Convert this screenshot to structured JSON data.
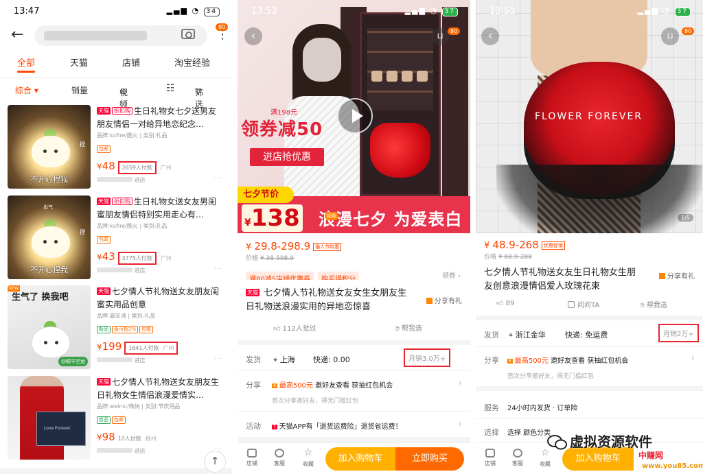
{
  "screen1": {
    "status": {
      "time": "13:47",
      "battery": "34"
    },
    "badge": "80",
    "tabs": [
      "全部",
      "天猫",
      "店铺",
      "淘宝经验"
    ],
    "filters": [
      "综合 ▾",
      "销量",
      "视频",
      "筛选"
    ],
    "items": [
      {
        "tags": [
          "天猫",
          "折扣购"
        ],
        "title": "生日礼物女七夕送男友朋友情侣一对给异地恋纪念…",
        "meta": "品牌:kufire/酷火 | 类别:礼品",
        "badges": [
          "包邮"
        ],
        "price": "48",
        "sold": "2659人付款",
        "location": "广州",
        "shop": "进店",
        "thumb_caption": "不开心捏我",
        "thumb_side": "捏"
      },
      {
        "tags": [
          "天猫",
          "折扣购"
        ],
        "title": "生日礼物女送女友男闺蜜朋友情侣特别实用走心有…",
        "meta": "品牌:kufire/酷火 | 类别:礼品",
        "badges": [
          "包邮"
        ],
        "price": "43",
        "sold": "3775人付款",
        "location": "广州",
        "shop": "进店",
        "thumb_caption": "不开心捏我",
        "thumb_side": "捏",
        "thumb_top": "出气"
      },
      {
        "tags": [
          "天猫"
        ],
        "title": "七夕情人节礼物送女友朋友闺蜜实用品创意",
        "meta": "品牌:赢安谱 | 类别:礼品",
        "badges": [
          "新品",
          "金币抵2%",
          "包邮"
        ],
        "price": "199",
        "sold": "1641人付款",
        "location": "广州",
        "shop": "进店",
        "thumb_top": "生气了 换我吧",
        "thumb_ribbon": "@顺丰空运",
        "thumb_corner": "NEW"
      },
      {
        "tags": [
          "天猫"
        ],
        "title": "七夕情人节礼物送女友朋友生日礼物女生情侣浪漫爱情实…",
        "meta": "品牌:welnic/微纳 | 类别:节庆用品",
        "badges": [
          "新品",
          "包邮"
        ],
        "price": "98",
        "sold": "10人付款",
        "location": "扬州",
        "shop": "进店",
        "box_text": "Love Forever"
      }
    ],
    "backtop": "↑"
  },
  "screen2": {
    "status": {
      "time": "13:53",
      "battery": "37"
    },
    "badge": "80",
    "promo_small": "满198元",
    "promo_big": "领券减50",
    "promo_button": "进店抢优惠",
    "qixi_label": "七夕节价",
    "qixi_price": "138",
    "slogan": "浪漫七夕 为爱表白",
    "video_tag": "视频",
    "price_range": "29.8-298.9",
    "price_tag": "猫人节特惠",
    "orig_label": "价格",
    "orig_price": "¥ 38-598.9",
    "coupons": [
      "满80减5店铺优惠券",
      "购买得积分"
    ],
    "coupon_right": "领券 ›",
    "title_tag": "天猫",
    "title": "七夕情人节礼物送女友女生女朋友生日礼物送浪漫实用的异地恋惊喜",
    "share": "分享有礼",
    "likes": "112人觉过",
    "help": "帮我选",
    "ship_label": "发货",
    "ship_loc": "上海",
    "ship_fee": "快递: 0.00",
    "monthly": "月销3.0万+",
    "share_label": "分享",
    "share_badge": "最高500元",
    "share_text": "邀好友查看 获抽红包机会",
    "share_sub": "首次分享邀好友，得无门槛红包",
    "activity_label": "活动",
    "activity_text": "天猫APP有「退货运费险」退货省运费！",
    "bottom": {
      "store": "店铺",
      "service": "客服",
      "fav": "收藏",
      "cart": "加入购物车",
      "buy": "立即购买"
    }
  },
  "screen3": {
    "status": {
      "time": "13:53",
      "battery": "37"
    },
    "badge": "80",
    "overlay_text": "FLOWER FOREVER",
    "pager": "1/5",
    "price_range": "48.9-268",
    "price_tag": "优惠促销",
    "orig_label": "价格",
    "orig_price": "¥ 68.9-288",
    "title": "七夕情人节礼物送女友生日礼物女生朋友创意浪漫情侣爱人玫瑰花束",
    "share": "分享有礼",
    "likes": "89",
    "ask": "问问TA",
    "help": "帮我选",
    "ship_label": "发货",
    "ship_loc": "浙江金华",
    "ship_fee": "快递: 免运费",
    "monthly": "月销2万+",
    "share_label": "分享",
    "share_badge": "最高500元",
    "share_text": "邀好友查看 获抽红包机会",
    "share_sub": "首次分享邀好友，得无门槛红包",
    "service_label": "服务",
    "service_text": "24小时内发货 · 订单险",
    "choose_label": "选择",
    "choose_text": "选择 颜色分类",
    "bottom": {
      "store": "店铺",
      "service": "客服",
      "fav": "收藏",
      "cart": "加入购物车"
    }
  },
  "watermark": {
    "text": "虚拟资源软件",
    "site": "中赚网",
    "url": "www.you85.com"
  }
}
